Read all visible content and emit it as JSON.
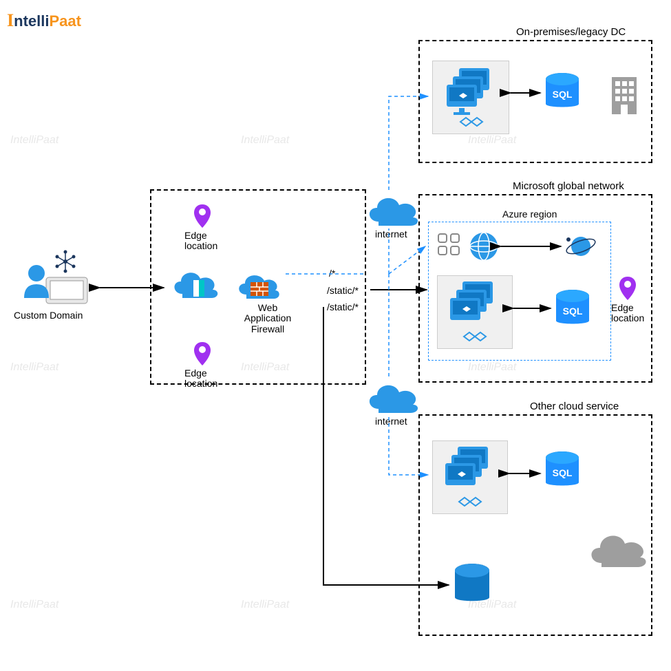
{
  "brand": {
    "name": "IntelliPaat",
    "accent": "#f7941d",
    "dark": "#1b365d"
  },
  "boxes": {
    "onprem": "On-premises/legacy DC",
    "msglobal": "Microsoft global network",
    "azureregion": "Azure region",
    "othercloud": "Other cloud service"
  },
  "labels": {
    "customdomain": "Custom Domain",
    "edgeloc1": "Edge location",
    "edgeloc2": "Edge location",
    "edgeloc3": "Edge location",
    "waf": "Web Application Firewall",
    "internet1": "internet",
    "internet2": "internet",
    "route1": "/*",
    "route2": "/static/*",
    "route3": "/static/*",
    "sql": "SQL"
  },
  "colors": {
    "azure": "#0078d4",
    "cloud": "#2b98e6",
    "pin": "#a030f0",
    "gray": "#9e9e9e",
    "firewall": "#d35400",
    "sql_ring": "#0a4f8a"
  }
}
